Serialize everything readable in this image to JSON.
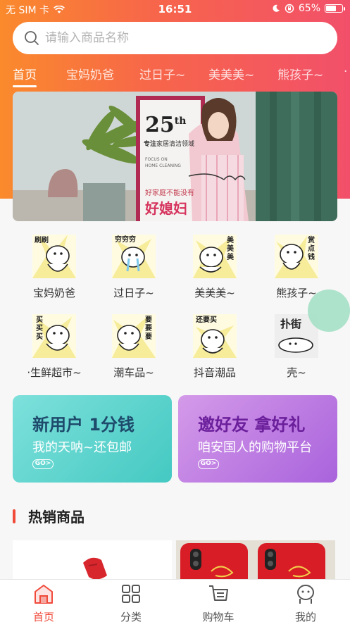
{
  "status_bar": {
    "carrier": "无 SIM 卡",
    "time": "16:51",
    "battery": "65%",
    "battery_level": 0.65
  },
  "search": {
    "placeholder": "请输入商品名称"
  },
  "tabs": [
    "首页",
    "宝妈奶爸",
    "过日子~",
    "美美美~",
    "熊孩子~"
  ],
  "banner": {
    "number": "25",
    "number_suffix": "th",
    "line1_bold": "专注",
    "line1_rest": "家居清洁领域",
    "focus_line1": "FOCUS ON",
    "focus_line2": "HOME CLEANING",
    "slogan_small": "好家庭不能没有",
    "slogan_big": "好媳妇"
  },
  "categories": [
    {
      "label": "宝妈奶爸",
      "sticker_text": "刷刷"
    },
    {
      "label": "过日子~",
      "sticker_text": "穷穷穷"
    },
    {
      "label": "美美美~",
      "sticker_text": "美美美"
    },
    {
      "label": "熊孩子~",
      "sticker_text": "赏点钱"
    },
    {
      "label": "·生鲜超市~",
      "sticker_text": "买买买"
    },
    {
      "label": "潮车品~",
      "sticker_text": "要要要"
    },
    {
      "label": "抖音潮品",
      "sticker_text": "还要买"
    },
    {
      "label": "壳~",
      "sticker_text": "扑街"
    }
  ],
  "promos": [
    {
      "title": "新用户 1分钱",
      "subtitle": "我的天呐~还包邮",
      "go": "GO>"
    },
    {
      "title": "邀好友 拿好礼",
      "subtitle": "咱安国人的购物平台",
      "go": "GO>"
    }
  ],
  "section": {
    "hot_title": "热销商品"
  },
  "tabbar": [
    {
      "label": "首页",
      "icon": "home-icon",
      "active": true
    },
    {
      "label": "分类",
      "icon": "grid-icon",
      "active": false
    },
    {
      "label": "购物车",
      "icon": "cart-icon",
      "active": false
    },
    {
      "label": "我的",
      "icon": "profile-icon",
      "active": false
    }
  ],
  "colors": {
    "gradient_start": "#fa8a2c",
    "gradient_end": "#f2506a",
    "accent": "#f04a3a",
    "promo1": "#49cfc8",
    "promo2": "#b96fe0"
  }
}
